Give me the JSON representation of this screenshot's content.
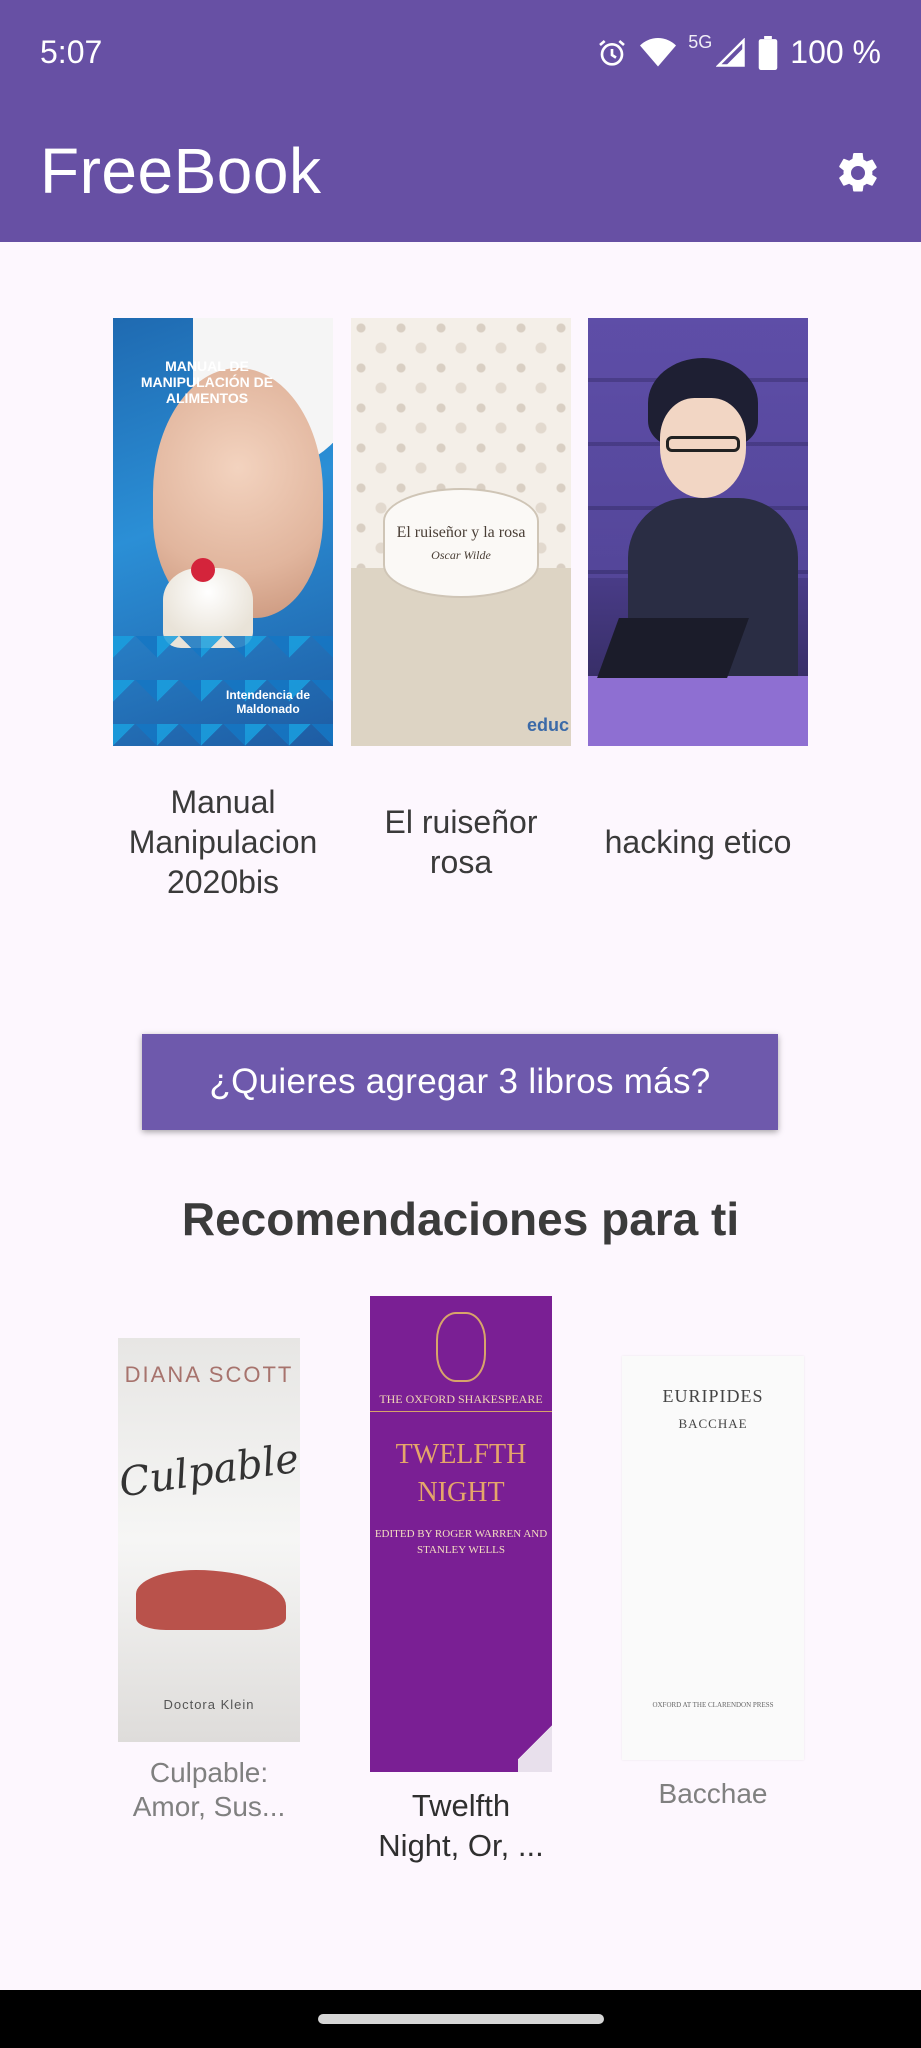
{
  "status_bar": {
    "time": "5:07",
    "network": "5G",
    "battery": "100 %"
  },
  "app_bar": {
    "title": "FreeBook",
    "settings_icon": "gear-icon"
  },
  "library": {
    "books": [
      {
        "title": "Manual Manipulacion 2020bis",
        "cover_text": "MANUAL DE MANIPULACIÓN DE ALIMENTOS",
        "cover_footer": "Intendencia de Maldonado"
      },
      {
        "title": "El ruiseñor rosa",
        "cover_text": "El ruiseñor y la rosa",
        "cover_author": "Oscar Wilde",
        "cover_publisher": "educ"
      },
      {
        "title": "hacking etico"
      }
    ]
  },
  "cta_label": "¿Quieres agregar 3 libros más?",
  "recommendations": {
    "heading": "Recomendaciones para ti",
    "items": [
      {
        "title": "Culpable: Amor, Sus...",
        "cover_author": "DIANA SCOTT",
        "cover_title": "Culpable",
        "cover_footer": "Doctora Klein"
      },
      {
        "title": "Twelfth Night, Or, ...",
        "cover_publisher": "THE OXFORD SHAKESPEARE",
        "cover_title": "TWELFTH NIGHT",
        "cover_editors": "EDITED BY ROGER WARREN AND STANLEY WELLS"
      },
      {
        "title": "Bacchae",
        "cover_author": "EURIPIDES",
        "cover_title": "BACCHAE",
        "cover_publisher": "OXFORD AT THE CLARENDON PRESS"
      }
    ]
  },
  "colors": {
    "primary": "#6750a4",
    "button": "#6e59ac",
    "background": "#fdf7fe"
  }
}
